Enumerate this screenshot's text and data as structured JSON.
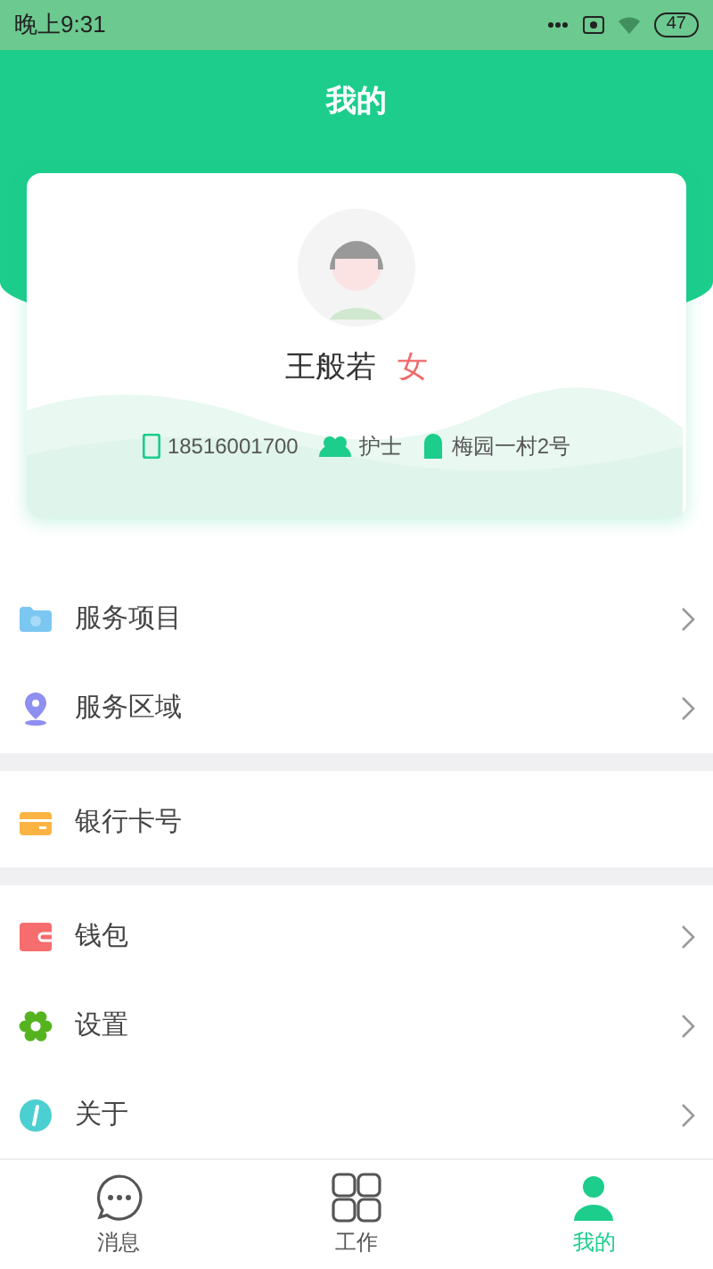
{
  "status_bar": {
    "time": "晚上9:31",
    "battery": "47"
  },
  "header": {
    "title": "我的"
  },
  "profile": {
    "name": "王般若",
    "gender": "女",
    "phone": "18516001700",
    "role": "护士",
    "address": "梅园一村2号"
  },
  "menu_groups": [
    {
      "items": [
        {
          "label": "服务项目",
          "kind": "folder",
          "chevron": true
        },
        {
          "label": "服务区域",
          "kind": "pin",
          "chevron": true
        }
      ]
    },
    {
      "items": [
        {
          "label": "银行卡号",
          "kind": "card",
          "chevron": false
        }
      ]
    },
    {
      "items": [
        {
          "label": "钱包",
          "kind": "wallet",
          "chevron": true
        },
        {
          "label": "设置",
          "kind": "gear",
          "chevron": true
        },
        {
          "label": "关于",
          "kind": "info",
          "chevron": true
        }
      ]
    }
  ],
  "tab_bar": [
    {
      "label": "消息",
      "kind": "chat",
      "selected": false
    },
    {
      "label": "工作",
      "kind": "grid",
      "selected": false
    },
    {
      "label": "我的",
      "kind": "person",
      "selected": true
    }
  ]
}
